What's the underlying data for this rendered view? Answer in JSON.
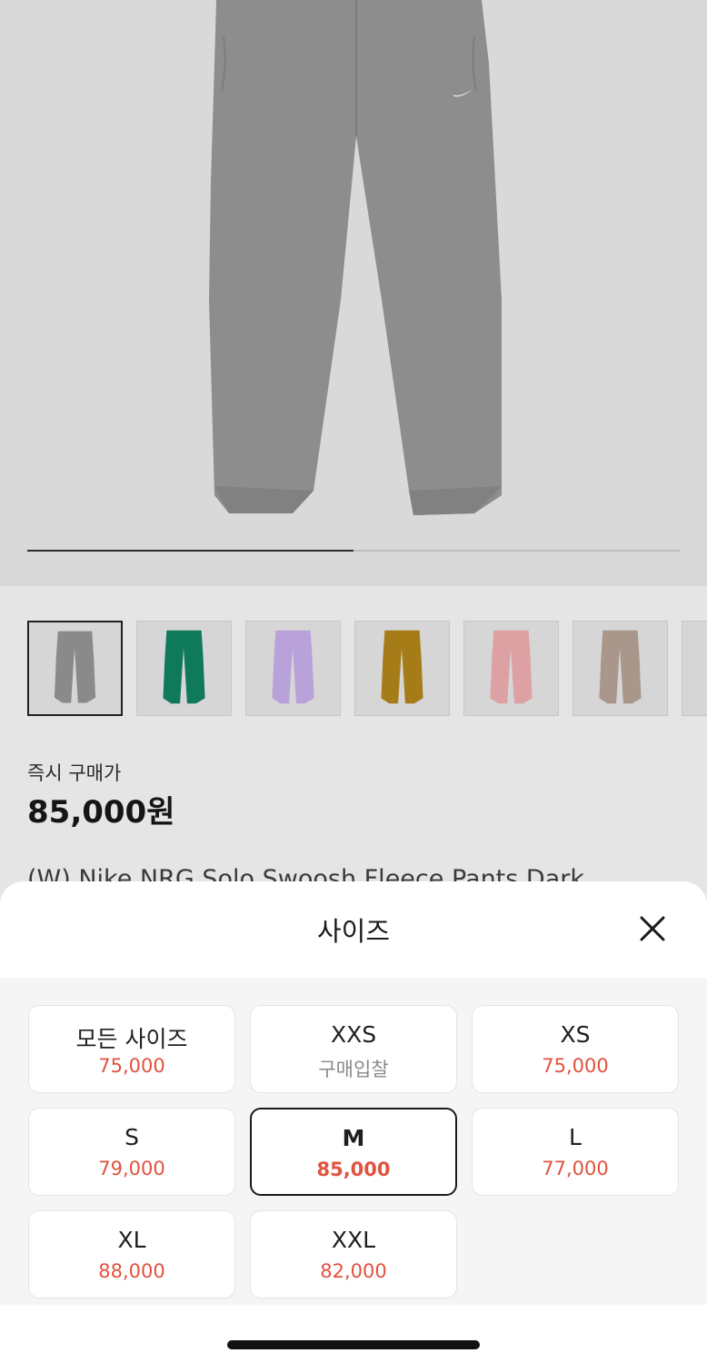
{
  "hero": {
    "image_icon": "sweatpants-grey",
    "progress": 0.5
  },
  "thumbnails": [
    {
      "color": "#8a8a8a",
      "active": true
    },
    {
      "color": "#0f7a5a",
      "active": false
    },
    {
      "color": "#b9a2d9",
      "active": false
    },
    {
      "color": "#a67c18",
      "active": false
    },
    {
      "color": "#dda0a3",
      "active": false
    },
    {
      "color": "#a8978a",
      "active": false
    }
  ],
  "price": {
    "label": "즉시 구매가",
    "value": "85,000원"
  },
  "product_name": "(W) Nike NRG Solo Swoosh Fleece Pants Dark",
  "sheet": {
    "title": "사이즈",
    "close_icon": "close-icon"
  },
  "sizes": [
    {
      "name": "모든 사이즈",
      "price": "75,000",
      "muted": false,
      "selected": false
    },
    {
      "name": "XXS",
      "price": "구매입찰",
      "muted": true,
      "selected": false
    },
    {
      "name": "XS",
      "price": "75,000",
      "muted": false,
      "selected": false
    },
    {
      "name": "S",
      "price": "79,000",
      "muted": false,
      "selected": false
    },
    {
      "name": "M",
      "price": "85,000",
      "muted": false,
      "selected": true
    },
    {
      "name": "L",
      "price": "77,000",
      "muted": false,
      "selected": false
    },
    {
      "name": "XL",
      "price": "88,000",
      "muted": false,
      "selected": false
    },
    {
      "name": "XXL",
      "price": "82,000",
      "muted": false,
      "selected": false
    }
  ],
  "colors": {
    "price_red": "#e0533f",
    "overlay": "#e5e5e5"
  }
}
